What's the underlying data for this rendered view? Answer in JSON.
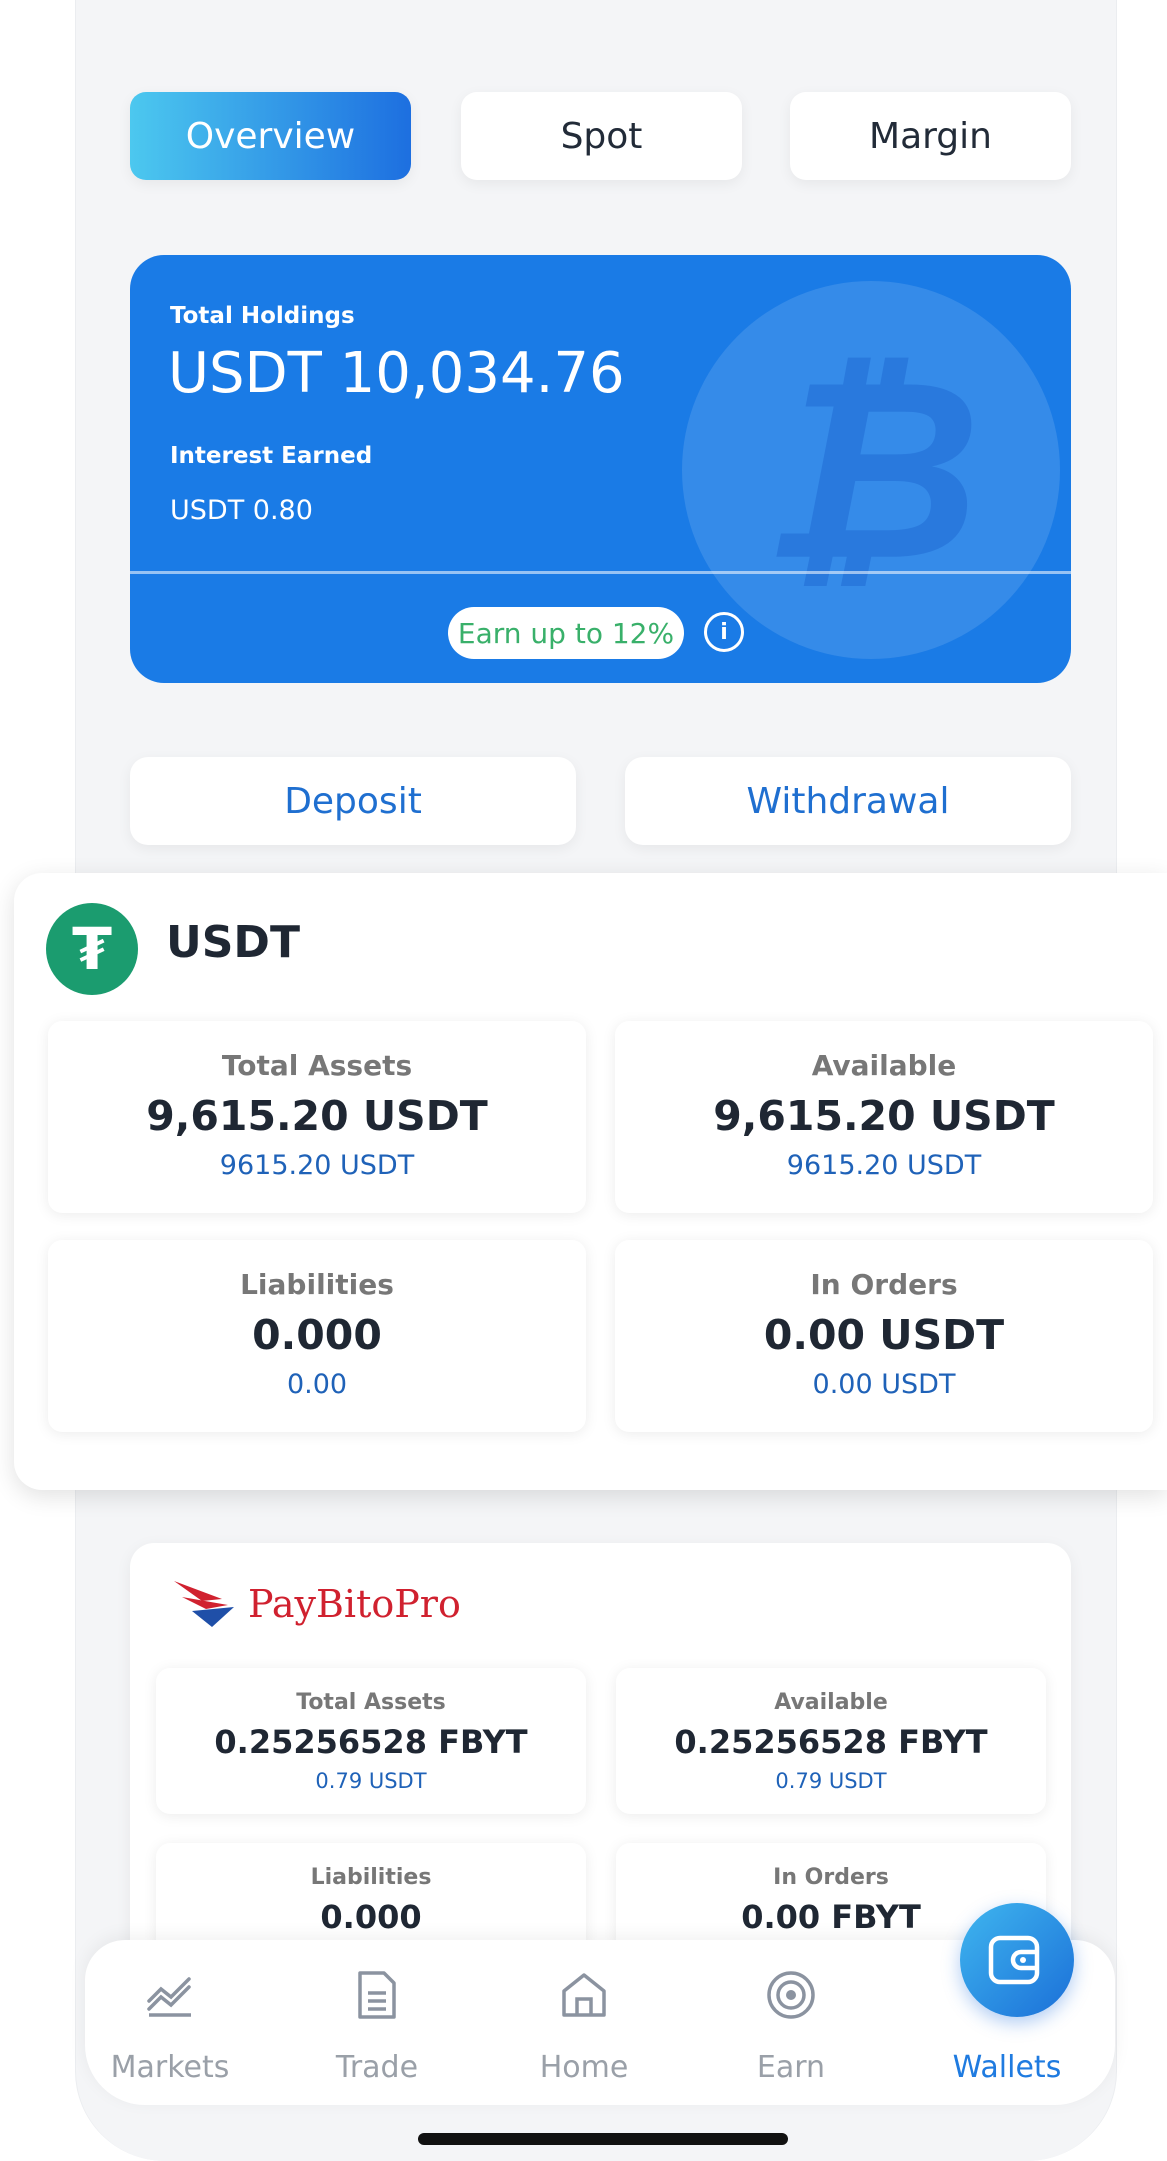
{
  "tabs": [
    {
      "label": "Overview",
      "active": true
    },
    {
      "label": "Spot",
      "active": false
    },
    {
      "label": "Margin",
      "active": false
    }
  ],
  "holdings": {
    "total_label": "Total Holdings",
    "total_value": "USDT 10,034.76",
    "interest_label": "Interest Earned",
    "interest_value": "USDT 0.80",
    "earn_badge": "Earn up to 12%",
    "info_icon": "info-icon",
    "bg_icon": "bitcoin-icon",
    "color": "#1a7be6"
  },
  "actions": {
    "deposit": "Deposit",
    "withdrawal": "Withdrawal"
  },
  "usdt": {
    "title": "USDT",
    "icon": "tether-icon",
    "stats": [
      {
        "label": "Total Assets",
        "value": "9,615.20 USDT",
        "sub": "9615.20 USDT"
      },
      {
        "label": "Available",
        "value": "9,615.20 USDT",
        "sub": "9615.20 USDT"
      },
      {
        "label": "Liabilities",
        "value": "0.000",
        "sub": "0.00"
      },
      {
        "label": "In Orders",
        "value": "0.00 USDT",
        "sub": "0.00 USDT"
      }
    ]
  },
  "paybito": {
    "brand": "PayBitoPro",
    "stats": [
      {
        "label": "Total Assets",
        "value": "0.25256528 FBYT",
        "sub": "0.79 USDT"
      },
      {
        "label": "Available",
        "value": "0.25256528 FBYT",
        "sub": "0.79 USDT"
      },
      {
        "label": "Liabilities",
        "value": "0.000",
        "sub": ""
      },
      {
        "label": "In Orders",
        "value": "0.00 FBYT",
        "sub": ""
      }
    ]
  },
  "nav": [
    {
      "label": "Markets",
      "icon": "chart-line-icon"
    },
    {
      "label": "Trade",
      "icon": "document-icon"
    },
    {
      "label": "Home",
      "icon": "home-icon"
    },
    {
      "label": "Earn",
      "icon": "target-icon"
    },
    {
      "label": "Wallets",
      "icon": "wallet-icon",
      "active": true
    }
  ],
  "colors": {
    "accent": "#1f7be0",
    "earn_green": "#39b06a",
    "brand_red": "#d0212f"
  }
}
